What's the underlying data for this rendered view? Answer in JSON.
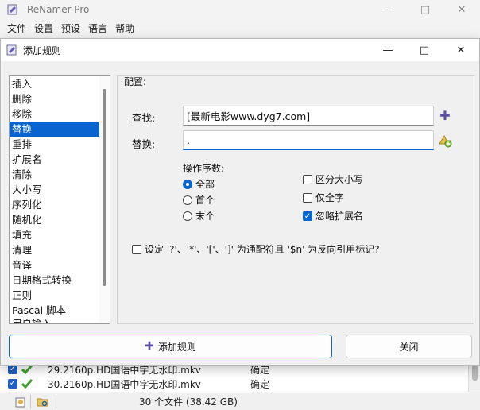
{
  "main_window": {
    "title": "ReNamer Pro",
    "menu": [
      "文件",
      "设置",
      "预设",
      "语言",
      "帮助"
    ],
    "files": [
      {
        "name": "29.2160p.HD国语中字无水印.mkv",
        "state": "确定"
      },
      {
        "name": "30.2160p.HD国语中字无水印.mkv",
        "state": "确定"
      }
    ],
    "status": "30 个文件 (38.42 GB)"
  },
  "dialog": {
    "title": "添加规则",
    "rules": [
      "插入",
      "删除",
      "移除",
      "替换",
      "重排",
      "扩展名",
      "清除",
      "大小写",
      "序列化",
      "随机化",
      "填充",
      "清理",
      "音译",
      "日期格式转换",
      "正则",
      "Pascal 脚本"
    ],
    "rules_cut": "用户输入",
    "selected_rule": "替换",
    "config_label": "配置:",
    "find_label": "查找:",
    "find_value": "[最新电影www.dyg7.com]",
    "replace_label": "替换:",
    "replace_value": ".",
    "occurrences_title": "操作序数:",
    "occurrences": [
      {
        "label": "全部",
        "selected": true
      },
      {
        "label": "首个",
        "selected": false
      },
      {
        "label": "末个",
        "selected": false
      }
    ],
    "options": [
      {
        "label": "区分大小写",
        "checked": false
      },
      {
        "label": "仅全字",
        "checked": false
      },
      {
        "label": "忽略扩展名",
        "checked": true
      }
    ],
    "wildcards_label": "设定 '?'、'*'、'['、']' 为通配符且 '$n' 为反向引用标记?",
    "wildcards_checked": false,
    "add_button": "添加规则",
    "close_button": "关闭"
  },
  "colors": {
    "accent": "#0a64d0",
    "plus_icon": "#5a4fa3",
    "check_green": "#3fa02f"
  }
}
